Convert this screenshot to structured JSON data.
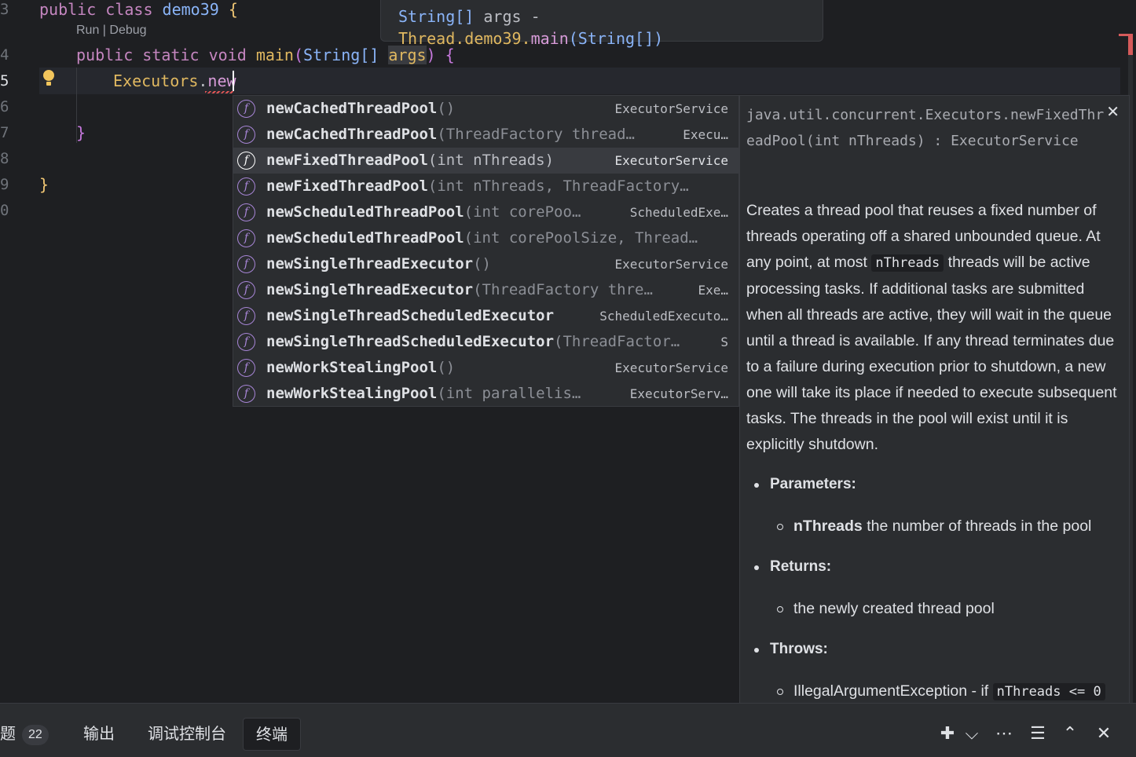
{
  "editor": {
    "lines": [
      {
        "num": "3",
        "tokens": [
          {
            "t": "public ",
            "c": "kw2"
          },
          {
            "t": "class ",
            "c": "kw2"
          },
          {
            "t": "demo39 ",
            "c": "cls"
          },
          {
            "t": "{",
            "c": "brace"
          }
        ]
      },
      {
        "num": "4",
        "tokens": [
          {
            "t": "public ",
            "c": "kw2"
          },
          {
            "t": "static ",
            "c": "kw2"
          },
          {
            "t": "void ",
            "c": "kw2"
          },
          {
            "t": "main",
            "c": "fn"
          },
          {
            "t": "(",
            "c": "brace2"
          },
          {
            "t": "String",
            "c": "cls"
          },
          {
            "t": "[] ",
            "c": "cls"
          },
          {
            "t": "args",
            "c": "fn"
          },
          {
            "t": ") ",
            "c": "brace2"
          },
          {
            "t": "{",
            "c": "brace2"
          }
        ]
      },
      {
        "num": "5",
        "tokens": [
          {
            "t": "Executors",
            "c": "fn"
          },
          {
            "t": ".",
            "c": "plain"
          },
          {
            "t": "new",
            "c": "method"
          }
        ]
      },
      {
        "num": "6",
        "tokens": []
      },
      {
        "num": "7",
        "tokens": [
          {
            "t": "}",
            "c": "brace2"
          }
        ]
      },
      {
        "num": "8",
        "tokens": []
      },
      {
        "num": "9",
        "tokens": [
          {
            "t": "}",
            "c": "brace"
          }
        ]
      },
      {
        "num": "0",
        "tokens": []
      }
    ],
    "inlay_hint": "Run | Debug",
    "active_line": "5"
  },
  "hint_tooltip": {
    "type": "String[]",
    "name": "args",
    "sep": " - ",
    "owner": "Thread.demo39.",
    "method": "main",
    "params": "(String[])"
  },
  "completion": {
    "items": [
      {
        "name": "newCachedThreadPool",
        "sig": "()",
        "type": "ExecutorService",
        "selected": false
      },
      {
        "name": "newCachedThreadPool",
        "sig": "(ThreadFactory thread…",
        "type": "Execu…",
        "selected": false
      },
      {
        "name": "newFixedThreadPool",
        "sig": "(int nThreads)",
        "type": "ExecutorService",
        "selected": true
      },
      {
        "name": "newFixedThreadPool",
        "sig": "(int nThreads, ThreadFactory…",
        "type": "",
        "selected": false
      },
      {
        "name": "newScheduledThreadPool",
        "sig": "(int corePoo…",
        "type": "ScheduledExe…",
        "selected": false
      },
      {
        "name": "newScheduledThreadPool",
        "sig": "(int corePoolSize, Thread…",
        "type": "",
        "selected": false
      },
      {
        "name": "newSingleThreadExecutor",
        "sig": "()",
        "type": "ExecutorService",
        "selected": false
      },
      {
        "name": "newSingleThreadExecutor",
        "sig": "(ThreadFactory thre…",
        "type": "Exe…",
        "selected": false
      },
      {
        "name": "newSingleThreadScheduledExecutor",
        "sig": "",
        "type": "ScheduledExecuto…",
        "selected": false
      },
      {
        "name": "newSingleThreadScheduledExecutor",
        "sig": "(ThreadFactor…",
        "type": "S",
        "selected": false
      },
      {
        "name": "newWorkStealingPool",
        "sig": "()",
        "type": "ExecutorService",
        "selected": false
      },
      {
        "name": "newWorkStealingPool",
        "sig": "(int parallelis…",
        "type": "ExecutorServ…",
        "selected": false
      }
    ],
    "icon_glyph": "f"
  },
  "doc": {
    "close_glyph": "✕",
    "signature": "java.util.concurrent.Executors.newFixedThreadPool(int nThreads) : ExecutorService",
    "desc_before": "Creates a thread pool that reuses a fixed number of threads operating off a shared unbounded queue. At any point, at most ",
    "desc_code": "nThreads",
    "desc_after": " threads will be active processing tasks. If additional tasks are submitted when all threads are active, they will wait in the queue until a thread is available. If any thread terminates due to a failure during execution prior to shutdown, a new one will take its place if needed to execute subsequent tasks. The threads in the pool will exist until it is explicitly shutdown.",
    "params_label": "Parameters:",
    "param_name": "nThreads",
    "param_desc": " the number of threads in the pool",
    "returns_label": "Returns:",
    "returns_desc": "the newly created thread pool",
    "throws_label": "Throws:",
    "throws_desc": "IllegalArgumentException - if ",
    "throws_code": "nThreads <= 0"
  },
  "panel": {
    "tabs": [
      {
        "label": "题",
        "badge": "22"
      },
      {
        "label": "输出"
      },
      {
        "label": "调试控制台"
      },
      {
        "label": "终端",
        "active": true
      }
    ],
    "tools": {
      "add": "✚",
      "dropdown": "⌵",
      "more": "⋯",
      "settings": "☰",
      "maximize": "⌃",
      "close": "✕"
    }
  },
  "colors": {
    "accent_error": "#d65b5b",
    "completion_icon": "#a785d6",
    "background": "#1e1f22"
  }
}
